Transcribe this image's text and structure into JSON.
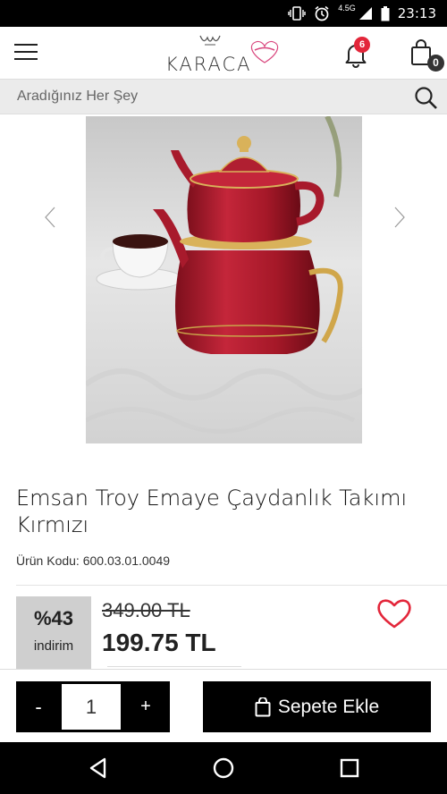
{
  "status_bar": {
    "time": "23:13",
    "network": "4.5G",
    "icons": [
      "vibrate-icon",
      "alarm-icon",
      "signal-icon",
      "battery-icon"
    ]
  },
  "header": {
    "logo_text": "KARACA",
    "notification_count": "6",
    "cart_count": "0"
  },
  "search": {
    "placeholder": "Aradığınız Her Şey"
  },
  "product": {
    "title": "Emsan Troy Emaye Çaydanlık Takımı Kırmızı",
    "code_text": "Ürün Kodu: 600.03.01.0049",
    "discount_percent": "%43",
    "discount_label": "indirim",
    "old_price": "349.00 TL",
    "new_price": "199.75 TL"
  },
  "actions": {
    "minus_label": "-",
    "plus_label": "+",
    "quantity": "1",
    "add_to_cart_label": "Sepete Ekle"
  },
  "colors": {
    "accent": "#000000",
    "badge_red": "#e3263a",
    "discount_bg": "#cfcfcf",
    "heart_red": "#e3263a"
  }
}
